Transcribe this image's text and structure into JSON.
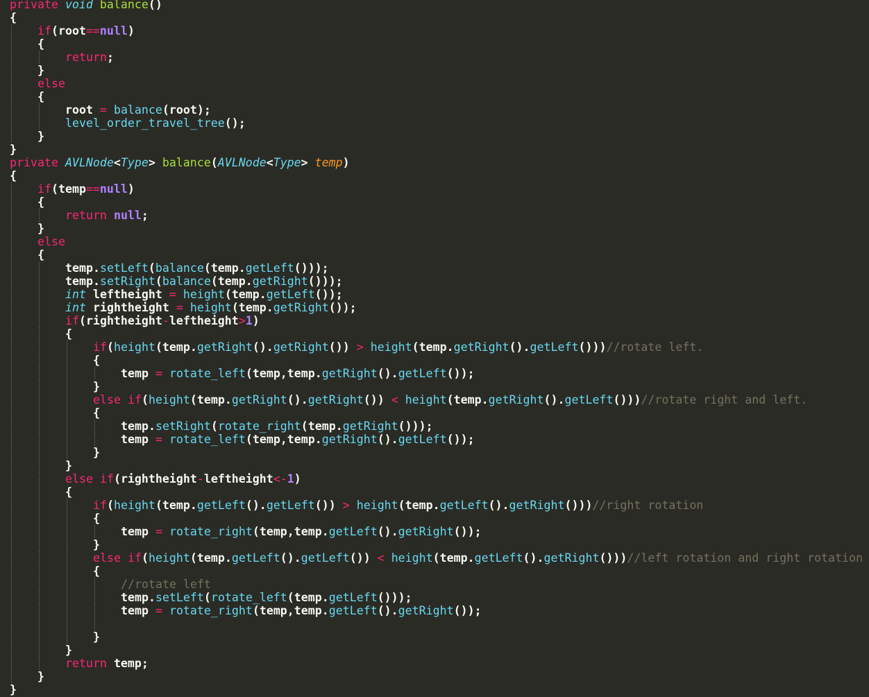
{
  "editor": {
    "language": "java",
    "theme": {
      "background": "#2b2b26",
      "text": "#f8f8f2",
      "keyword": "#f92672",
      "storage_type": "#66d9ef",
      "function_name": "#a6e22e",
      "parameter": "#fd971f",
      "constant": "#ae81ff",
      "method_call": "#66d9ef",
      "comment": "#75715e"
    },
    "lines": [
      {
        "indent": 0,
        "tokens": [
          [
            "kw",
            "private"
          ],
          [
            "tx",
            " "
          ],
          [
            "st",
            "void"
          ],
          [
            "tx",
            " "
          ],
          [
            "fn",
            "balance"
          ],
          [
            "tx",
            "()"
          ]
        ]
      },
      {
        "indent": 0,
        "tokens": [
          [
            "tx",
            "{"
          ]
        ]
      },
      {
        "indent": 1,
        "tokens": [
          [
            "kw",
            "if"
          ],
          [
            "tx",
            "(root"
          ],
          [
            "op",
            "=="
          ],
          [
            "cn",
            "null"
          ],
          [
            "tx",
            ")"
          ]
        ]
      },
      {
        "indent": 1,
        "tokens": [
          [
            "tx",
            "{"
          ]
        ]
      },
      {
        "indent": 2,
        "tokens": [
          [
            "kw",
            "return"
          ],
          [
            "tx",
            ";"
          ]
        ]
      },
      {
        "indent": 1,
        "tokens": [
          [
            "tx",
            "}"
          ]
        ]
      },
      {
        "indent": 1,
        "tokens": [
          [
            "kw",
            "else"
          ]
        ]
      },
      {
        "indent": 1,
        "tokens": [
          [
            "tx",
            "{"
          ]
        ]
      },
      {
        "indent": 2,
        "tokens": [
          [
            "tx",
            "root "
          ],
          [
            "op",
            "="
          ],
          [
            "tx",
            " "
          ],
          [
            "ca",
            "balance"
          ],
          [
            "tx",
            "(root);"
          ]
        ]
      },
      {
        "indent": 2,
        "tokens": [
          [
            "ca",
            "level_order_travel_tree"
          ],
          [
            "tx",
            "();"
          ]
        ]
      },
      {
        "indent": 1,
        "tokens": [
          [
            "tx",
            "}"
          ]
        ]
      },
      {
        "indent": 0,
        "tokens": [
          [
            "tx",
            "}"
          ]
        ]
      },
      {
        "indent": 0,
        "tokens": [
          [
            "kw",
            "private"
          ],
          [
            "tx",
            " "
          ],
          [
            "st",
            "AVLNode"
          ],
          [
            "tx",
            "<"
          ],
          [
            "st",
            "Type"
          ],
          [
            "tx",
            "> "
          ],
          [
            "fn",
            "balance"
          ],
          [
            "tx",
            "("
          ],
          [
            "st",
            "AVLNode"
          ],
          [
            "tx",
            "<"
          ],
          [
            "st",
            "Type"
          ],
          [
            "tx",
            "> "
          ],
          [
            "pa",
            "temp"
          ],
          [
            "tx",
            ")"
          ]
        ]
      },
      {
        "indent": 0,
        "tokens": [
          [
            "tx",
            "{"
          ]
        ]
      },
      {
        "indent": 1,
        "tokens": [
          [
            "kw",
            "if"
          ],
          [
            "tx",
            "(temp"
          ],
          [
            "op",
            "=="
          ],
          [
            "cn",
            "null"
          ],
          [
            "tx",
            ")"
          ]
        ]
      },
      {
        "indent": 1,
        "tokens": [
          [
            "tx",
            "{"
          ]
        ]
      },
      {
        "indent": 2,
        "tokens": [
          [
            "kw",
            "return"
          ],
          [
            "tx",
            " "
          ],
          [
            "cn",
            "null"
          ],
          [
            "tx",
            ";"
          ]
        ]
      },
      {
        "indent": 1,
        "tokens": [
          [
            "tx",
            "}"
          ]
        ]
      },
      {
        "indent": 1,
        "tokens": [
          [
            "kw",
            "else"
          ]
        ]
      },
      {
        "indent": 1,
        "tokens": [
          [
            "tx",
            "{"
          ]
        ]
      },
      {
        "indent": 2,
        "tokens": [
          [
            "tx",
            "temp."
          ],
          [
            "ca",
            "setLeft"
          ],
          [
            "tx",
            "("
          ],
          [
            "ca",
            "balance"
          ],
          [
            "tx",
            "(temp."
          ],
          [
            "ca",
            "getLeft"
          ],
          [
            "tx",
            "()));"
          ]
        ]
      },
      {
        "indent": 2,
        "tokens": [
          [
            "tx",
            "temp."
          ],
          [
            "ca",
            "setRight"
          ],
          [
            "tx",
            "("
          ],
          [
            "ca",
            "balance"
          ],
          [
            "tx",
            "(temp."
          ],
          [
            "ca",
            "getRight"
          ],
          [
            "tx",
            "()));"
          ]
        ]
      },
      {
        "indent": 2,
        "tokens": [
          [
            "st",
            "int"
          ],
          [
            "tx",
            " leftheight "
          ],
          [
            "op",
            "="
          ],
          [
            "tx",
            " "
          ],
          [
            "ca",
            "height"
          ],
          [
            "tx",
            "(temp."
          ],
          [
            "ca",
            "getLeft"
          ],
          [
            "tx",
            "());"
          ]
        ]
      },
      {
        "indent": 2,
        "tokens": [
          [
            "st",
            "int"
          ],
          [
            "tx",
            " rightheight "
          ],
          [
            "op",
            "="
          ],
          [
            "tx",
            " "
          ],
          [
            "ca",
            "height"
          ],
          [
            "tx",
            "(temp."
          ],
          [
            "ca",
            "getRight"
          ],
          [
            "tx",
            "());"
          ]
        ]
      },
      {
        "indent": 2,
        "tokens": [
          [
            "kw",
            "if"
          ],
          [
            "tx",
            "(rightheight"
          ],
          [
            "op",
            "-"
          ],
          [
            "tx",
            "leftheight"
          ],
          [
            "op",
            ">"
          ],
          [
            "cn",
            "1"
          ],
          [
            "tx",
            ")"
          ]
        ]
      },
      {
        "indent": 2,
        "tokens": [
          [
            "tx",
            "{"
          ]
        ]
      },
      {
        "indent": 3,
        "tokens": [
          [
            "kw",
            "if"
          ],
          [
            "tx",
            "("
          ],
          [
            "ca",
            "height"
          ],
          [
            "tx",
            "(temp."
          ],
          [
            "ca",
            "getRight"
          ],
          [
            "tx",
            "()."
          ],
          [
            "ca",
            "getRight"
          ],
          [
            "tx",
            "()) "
          ],
          [
            "op",
            ">"
          ],
          [
            "tx",
            " "
          ],
          [
            "ca",
            "height"
          ],
          [
            "tx",
            "(temp."
          ],
          [
            "ca",
            "getRight"
          ],
          [
            "tx",
            "()."
          ],
          [
            "ca",
            "getLeft"
          ],
          [
            "tx",
            "()))"
          ],
          [
            "cm",
            "//rotate left."
          ]
        ]
      },
      {
        "indent": 3,
        "tokens": [
          [
            "tx",
            "{"
          ]
        ]
      },
      {
        "indent": 4,
        "tokens": [
          [
            "tx",
            "temp "
          ],
          [
            "op",
            "="
          ],
          [
            "tx",
            " "
          ],
          [
            "ca",
            "rotate_left"
          ],
          [
            "tx",
            "(temp,temp."
          ],
          [
            "ca",
            "getRight"
          ],
          [
            "tx",
            "()."
          ],
          [
            "ca",
            "getLeft"
          ],
          [
            "tx",
            "());"
          ]
        ]
      },
      {
        "indent": 3,
        "tokens": [
          [
            "tx",
            "}"
          ]
        ]
      },
      {
        "indent": 3,
        "tokens": [
          [
            "kw",
            "else"
          ],
          [
            "tx",
            " "
          ],
          [
            "kw",
            "if"
          ],
          [
            "tx",
            "("
          ],
          [
            "ca",
            "height"
          ],
          [
            "tx",
            "(temp."
          ],
          [
            "ca",
            "getRight"
          ],
          [
            "tx",
            "()."
          ],
          [
            "ca",
            "getRight"
          ],
          [
            "tx",
            "()) "
          ],
          [
            "op",
            "<"
          ],
          [
            "tx",
            " "
          ],
          [
            "ca",
            "height"
          ],
          [
            "tx",
            "(temp."
          ],
          [
            "ca",
            "getRight"
          ],
          [
            "tx",
            "()."
          ],
          [
            "ca",
            "getLeft"
          ],
          [
            "tx",
            "()))"
          ],
          [
            "cm",
            "//rotate right and left."
          ]
        ]
      },
      {
        "indent": 3,
        "tokens": [
          [
            "tx",
            "{"
          ]
        ]
      },
      {
        "indent": 4,
        "tokens": [
          [
            "tx",
            "temp."
          ],
          [
            "ca",
            "setRight"
          ],
          [
            "tx",
            "("
          ],
          [
            "ca",
            "rotate_right"
          ],
          [
            "tx",
            "(temp."
          ],
          [
            "ca",
            "getRight"
          ],
          [
            "tx",
            "()));"
          ]
        ]
      },
      {
        "indent": 4,
        "tokens": [
          [
            "tx",
            "temp "
          ],
          [
            "op",
            "="
          ],
          [
            "tx",
            " "
          ],
          [
            "ca",
            "rotate_left"
          ],
          [
            "tx",
            "(temp,temp."
          ],
          [
            "ca",
            "getRight"
          ],
          [
            "tx",
            "()."
          ],
          [
            "ca",
            "getLeft"
          ],
          [
            "tx",
            "());"
          ]
        ]
      },
      {
        "indent": 3,
        "tokens": [
          [
            "tx",
            "}"
          ]
        ]
      },
      {
        "indent": 2,
        "tokens": [
          [
            "tx",
            "}"
          ]
        ]
      },
      {
        "indent": 2,
        "tokens": [
          [
            "kw",
            "else"
          ],
          [
            "tx",
            " "
          ],
          [
            "kw",
            "if"
          ],
          [
            "tx",
            "(rightheight"
          ],
          [
            "op",
            "-"
          ],
          [
            "tx",
            "leftheight"
          ],
          [
            "op",
            "<-"
          ],
          [
            "cn",
            "1"
          ],
          [
            "tx",
            ")"
          ]
        ]
      },
      {
        "indent": 2,
        "tokens": [
          [
            "tx",
            "{"
          ]
        ]
      },
      {
        "indent": 3,
        "tokens": [
          [
            "kw",
            "if"
          ],
          [
            "tx",
            "("
          ],
          [
            "ca",
            "height"
          ],
          [
            "tx",
            "(temp."
          ],
          [
            "ca",
            "getLeft"
          ],
          [
            "tx",
            "()."
          ],
          [
            "ca",
            "getLeft"
          ],
          [
            "tx",
            "()) "
          ],
          [
            "op",
            ">"
          ],
          [
            "tx",
            " "
          ],
          [
            "ca",
            "height"
          ],
          [
            "tx",
            "(temp."
          ],
          [
            "ca",
            "getLeft"
          ],
          [
            "tx",
            "()."
          ],
          [
            "ca",
            "getRight"
          ],
          [
            "tx",
            "()))"
          ],
          [
            "cm",
            "//right rotation"
          ]
        ]
      },
      {
        "indent": 3,
        "tokens": [
          [
            "tx",
            "{"
          ]
        ]
      },
      {
        "indent": 4,
        "tokens": [
          [
            "tx",
            "temp "
          ],
          [
            "op",
            "="
          ],
          [
            "tx",
            " "
          ],
          [
            "ca",
            "rotate_right"
          ],
          [
            "tx",
            "(temp,temp."
          ],
          [
            "ca",
            "getLeft"
          ],
          [
            "tx",
            "()."
          ],
          [
            "ca",
            "getRight"
          ],
          [
            "tx",
            "());"
          ]
        ]
      },
      {
        "indent": 3,
        "tokens": [
          [
            "tx",
            "}"
          ]
        ]
      },
      {
        "indent": 3,
        "tokens": [
          [
            "kw",
            "else"
          ],
          [
            "tx",
            " "
          ],
          [
            "kw",
            "if"
          ],
          [
            "tx",
            "("
          ],
          [
            "ca",
            "height"
          ],
          [
            "tx",
            "(temp."
          ],
          [
            "ca",
            "getLeft"
          ],
          [
            "tx",
            "()."
          ],
          [
            "ca",
            "getLeft"
          ],
          [
            "tx",
            "()) "
          ],
          [
            "op",
            "<"
          ],
          [
            "tx",
            " "
          ],
          [
            "ca",
            "height"
          ],
          [
            "tx",
            "(temp."
          ],
          [
            "ca",
            "getLeft"
          ],
          [
            "tx",
            "()."
          ],
          [
            "ca",
            "getRight"
          ],
          [
            "tx",
            "()))"
          ],
          [
            "cm",
            "//left rotation and right rotation"
          ]
        ]
      },
      {
        "indent": 3,
        "tokens": [
          [
            "tx",
            "{"
          ]
        ]
      },
      {
        "indent": 4,
        "tokens": [
          [
            "cm",
            "//rotate left"
          ]
        ]
      },
      {
        "indent": 4,
        "tokens": [
          [
            "tx",
            "temp."
          ],
          [
            "ca",
            "setLeft"
          ],
          [
            "tx",
            "("
          ],
          [
            "ca",
            "rotate_left"
          ],
          [
            "tx",
            "(temp."
          ],
          [
            "ca",
            "getLeft"
          ],
          [
            "tx",
            "()));"
          ]
        ]
      },
      {
        "indent": 4,
        "tokens": [
          [
            "tx",
            "temp "
          ],
          [
            "op",
            "="
          ],
          [
            "tx",
            " "
          ],
          [
            "ca",
            "rotate_right"
          ],
          [
            "tx",
            "(temp,temp."
          ],
          [
            "ca",
            "getLeft"
          ],
          [
            "tx",
            "()."
          ],
          [
            "ca",
            "getRight"
          ],
          [
            "tx",
            "());"
          ]
        ]
      },
      {
        "indent": 4,
        "tokens": []
      },
      {
        "indent": 3,
        "tokens": [
          [
            "tx",
            "}"
          ]
        ]
      },
      {
        "indent": 2,
        "tokens": [
          [
            "tx",
            "}"
          ]
        ]
      },
      {
        "indent": 2,
        "tokens": [
          [
            "kw",
            "return"
          ],
          [
            "tx",
            " temp;"
          ]
        ]
      },
      {
        "indent": 1,
        "tokens": [
          [
            "tx",
            "}"
          ]
        ]
      },
      {
        "indent": 0,
        "tokens": [
          [
            "tx",
            "}"
          ]
        ]
      }
    ]
  }
}
